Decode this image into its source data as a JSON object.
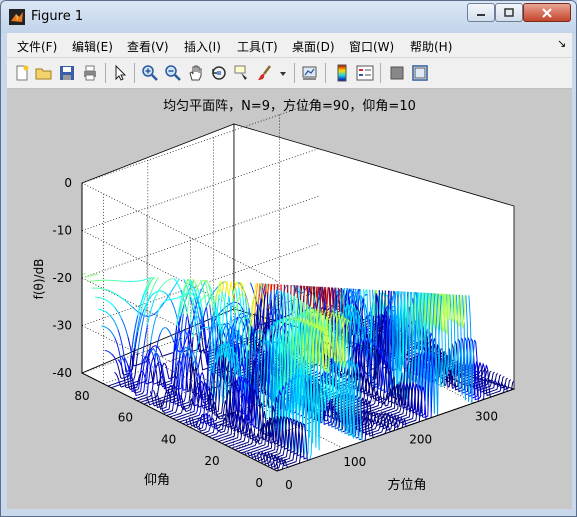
{
  "window": {
    "title": "Figure 1"
  },
  "menu": [
    "文件(F)",
    "编辑(E)",
    "查看(V)",
    "插入(I)",
    "工具(T)",
    "桌面(D)",
    "窗口(W)",
    "帮助(H)"
  ],
  "toolbar_icons": [
    "new-figure-icon",
    "open-file-icon",
    "save-icon",
    "print-icon",
    "select-arrow-icon",
    "zoom-in-icon",
    "zoom-out-icon",
    "pan-hand-icon",
    "rotate-3d-icon",
    "data-cursor-icon",
    "brush-icon",
    "brush-dropdown-icon",
    "link-plot-icon",
    "colorbar-icon",
    "legend-icon",
    "hide-plot-tools-icon",
    "show-plot-tools-icon"
  ],
  "colors": {
    "figure_bg": "#c8c8c8",
    "axes_bg": "#ffffff",
    "colormap": "jet"
  },
  "chart_data": {
    "type": "surface",
    "title": "均匀平面阵，N=9，方位角=90，仰角=10",
    "zlabel": "f(θ)/dB",
    "xlabel": "方位角",
    "ylabel": "仰角",
    "z_ticks": [
      "0",
      "-10",
      "-20",
      "-30",
      "-40"
    ],
    "x_ticks": [
      "0",
      "100",
      "200",
      "300"
    ],
    "y_ticks": [
      "0",
      "20",
      "40",
      "60",
      "80"
    ],
    "zlim": [
      -40,
      0
    ],
    "xlim": [
      0,
      360
    ],
    "ylim": [
      0,
      90
    ],
    "grid": true,
    "array_elements": 9,
    "steer_azimuth": 90,
    "steer_elevation": 10
  }
}
